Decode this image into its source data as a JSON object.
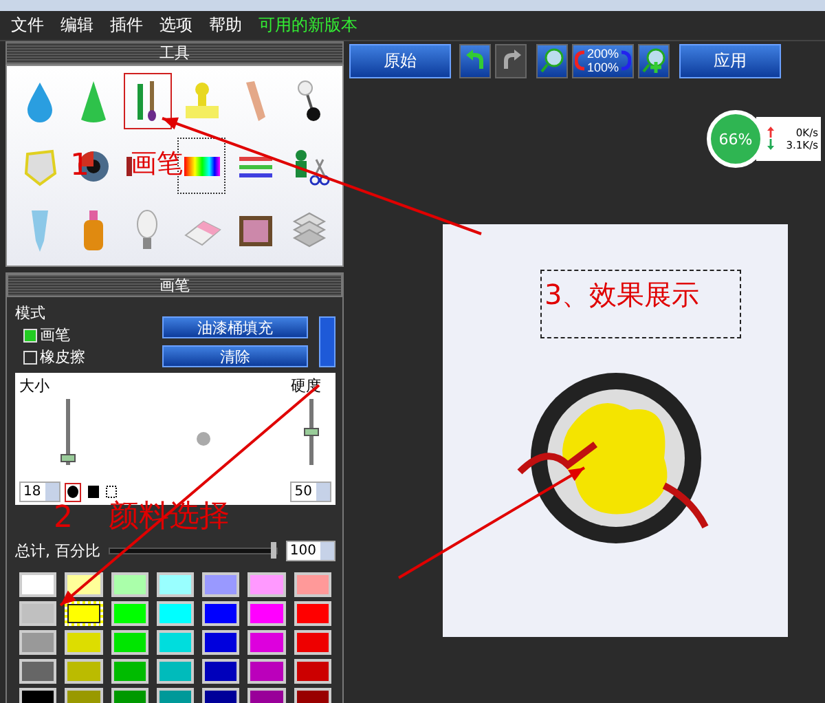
{
  "menu": [
    {
      "label": "文件",
      "kind": "menu"
    },
    {
      "label": "编辑",
      "kind": "menu"
    },
    {
      "label": "插件",
      "kind": "menu"
    },
    {
      "label": "选项",
      "kind": "menu"
    },
    {
      "label": "帮助",
      "kind": "menu"
    },
    {
      "label": "可用的新版本",
      "kind": "update"
    }
  ],
  "tools_panel": {
    "title": "工具",
    "tools": [
      {
        "selected": false,
        "focused": false
      },
      {
        "selected": false,
        "focused": false
      },
      {
        "selected": true,
        "focused": false
      },
      {
        "selected": false,
        "focused": false
      },
      {
        "selected": false,
        "focused": false
      },
      {
        "selected": false,
        "focused": false
      },
      {
        "selected": false,
        "focused": false
      },
      {
        "selected": false,
        "focused": false
      },
      {
        "selected": false,
        "focused": false
      },
      {
        "selected": false,
        "focused": true
      },
      {
        "selected": false,
        "focused": false
      },
      {
        "selected": false,
        "focused": false
      },
      {
        "selected": false,
        "focused": false
      },
      {
        "selected": false,
        "focused": false
      },
      {
        "selected": false,
        "focused": false
      },
      {
        "selected": false,
        "focused": false
      },
      {
        "selected": false,
        "focused": false
      },
      {
        "selected": false,
        "focused": false
      }
    ]
  },
  "annotations": {
    "tool": {
      "number": "1",
      "text": "画笔"
    },
    "color": {
      "number": "2",
      "text": "颜料选择"
    },
    "result": {
      "text": "3、效果展示"
    }
  },
  "brush_panel": {
    "title": "画笔",
    "mode_label": "模式",
    "modes": [
      {
        "label": "画笔",
        "selected": true
      },
      {
        "label": "橡皮擦",
        "selected": false
      }
    ],
    "buttons": [
      "油漆桶填充",
      "清除"
    ],
    "size": {
      "label": "大小",
      "value": "18",
      "level": 0.1
    },
    "hardness": {
      "label": "硬度",
      "value": "50",
      "level": 0.5
    },
    "shapes": [
      {
        "kind": "round",
        "selected": true
      },
      {
        "kind": "square",
        "selected": false
      }
    ],
    "total": {
      "label": "总计, 百分比",
      "value": "100",
      "level": 1
    },
    "colors": [
      {
        "color": "#ffffff",
        "selected": false
      },
      {
        "color": "#ffff99",
        "selected": false
      },
      {
        "color": "#aaffaa",
        "selected": false
      },
      {
        "color": "#99ffff",
        "selected": false
      },
      {
        "color": "#9999ff",
        "selected": false
      },
      {
        "color": "#ff99ff",
        "selected": false
      },
      {
        "color": "#ff9999",
        "selected": false
      },
      {
        "color": "#c0c0c0",
        "selected": false
      },
      {
        "color": "#ffff00",
        "selected": true
      },
      {
        "color": "#00ff00",
        "selected": false
      },
      {
        "color": "#00ffff",
        "selected": false
      },
      {
        "color": "#0000ff",
        "selected": false
      },
      {
        "color": "#ff00ff",
        "selected": false
      },
      {
        "color": "#ff0000",
        "selected": false
      },
      {
        "color": "#999999",
        "selected": false
      },
      {
        "color": "#dddd00",
        "selected": false
      },
      {
        "color": "#00e600",
        "selected": false
      },
      {
        "color": "#00dddd",
        "selected": false
      },
      {
        "color": "#0000dd",
        "selected": false
      },
      {
        "color": "#dd00dd",
        "selected": false
      },
      {
        "color": "#ee0000",
        "selected": false
      },
      {
        "color": "#666666",
        "selected": false
      },
      {
        "color": "#bbbb00",
        "selected": false
      },
      {
        "color": "#00bb00",
        "selected": false
      },
      {
        "color": "#00bbbb",
        "selected": false
      },
      {
        "color": "#0000bb",
        "selected": false
      },
      {
        "color": "#bb00bb",
        "selected": false
      },
      {
        "color": "#cc0000",
        "selected": false
      },
      {
        "color": "#000000",
        "selected": false
      },
      {
        "color": "#999900",
        "selected": false
      },
      {
        "color": "#009900",
        "selected": false
      },
      {
        "color": "#009999",
        "selected": false
      },
      {
        "color": "#000099",
        "selected": false
      },
      {
        "color": "#990099",
        "selected": false
      },
      {
        "color": "#990000",
        "selected": false
      }
    ]
  },
  "toolbar": {
    "original": "原始",
    "zoom": [
      "200%",
      "100%"
    ],
    "apply": "应用"
  },
  "net_widget": {
    "percent": "66%",
    "up": "0K/s",
    "down": "3.1K/s"
  }
}
